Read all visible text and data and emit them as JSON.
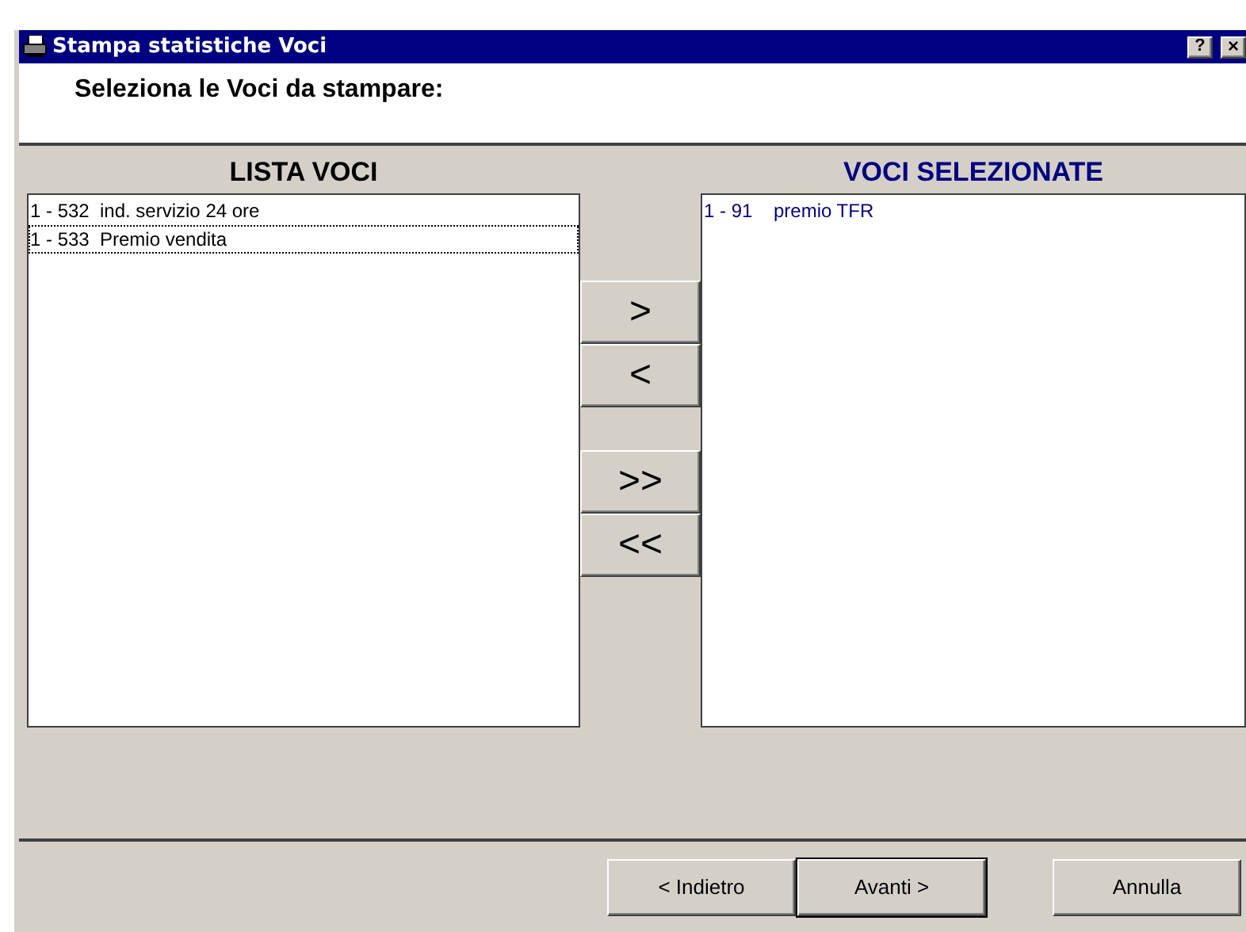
{
  "window": {
    "title": "Stampa statistiche Voci",
    "help_button": "?",
    "close_button": "×"
  },
  "instruction": "Seleziona le Voci da stampare:",
  "left_list": {
    "heading": "LISTA VOCI",
    "items": [
      {
        "code": "1 - 532",
        "label": "ind. servizio 24 ore",
        "focused": false
      },
      {
        "code": "1 - 533",
        "label": "Premio vendita",
        "focused": true
      }
    ]
  },
  "move_buttons": [
    ">",
    "<",
    ">>",
    "<<"
  ],
  "right_list": {
    "heading": "VOCI SELEZIONATE",
    "items": [
      {
        "code": "1 - 91",
        "label": "premio TFR",
        "focused": false
      }
    ]
  },
  "footer_buttons": [
    {
      "label": "< Indietro",
      "default": false
    },
    {
      "label": "Avanti >",
      "default": true
    },
    {
      "label": "Annulla",
      "default": false
    }
  ]
}
